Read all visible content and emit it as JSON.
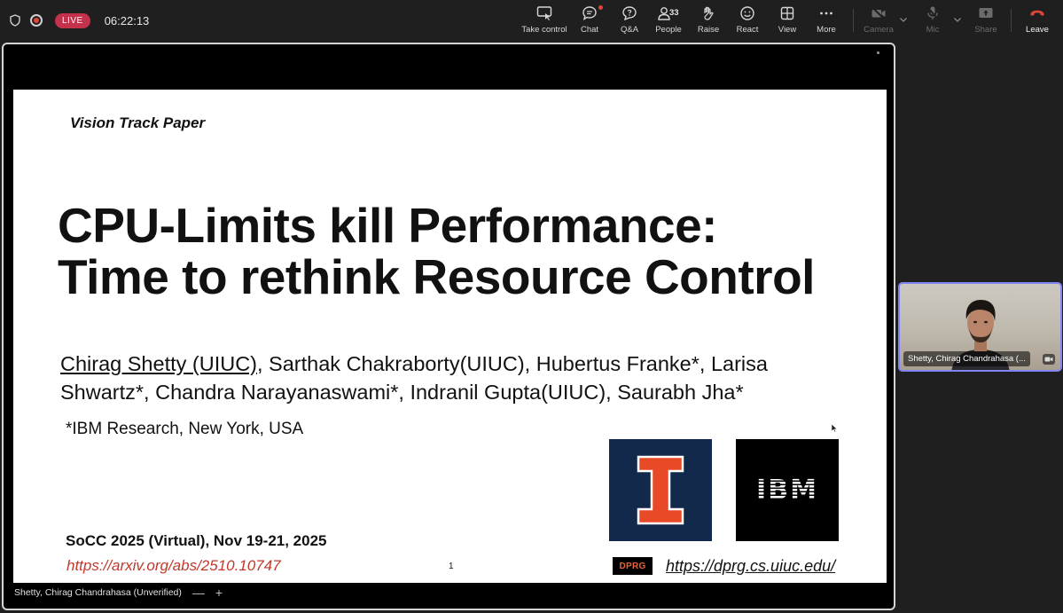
{
  "status": {
    "live_label": "LIVE",
    "timer": "06:22:13"
  },
  "toolbar": {
    "take_control": "Take control",
    "chat": "Chat",
    "qa": "Q&A",
    "people": "People",
    "people_count": "33",
    "raise": "Raise",
    "react": "React",
    "view": "View",
    "more": "More",
    "camera": "Camera",
    "mic": "Mic",
    "share": "Share",
    "leave": "Leave",
    "leave_color": "#e0453a"
  },
  "slide": {
    "track": "Vision Track Paper",
    "title_line1": "CPU-Limits kill Performance:",
    "title_line2": "Time to rethink Resource Control",
    "author_presenter": "Chirag Shetty (UIUC)",
    "authors_rest_line1": ", Sarthak Chakraborty(UIUC), Hubertus Franke*, Larisa",
    "authors_line2": "Shwartz*, Chandra Narayanaswami*, Indranil Gupta(UIUC), Saurabh Jha*",
    "affiliation": "*IBM Research, New York, USA",
    "conference": "SoCC 2025 (Virtual), Nov 19-21, 2025",
    "arxiv_link": "https://arxiv.org/abs/2510.10747",
    "page_number": "1",
    "ibm_logo": "IBM",
    "dprg_logo": "DPRG",
    "dprg_link": "https://dprg.cs.uiuc.edu/",
    "illinois_orange": "#e84a27",
    "illinois_blue": "#13294b"
  },
  "presenter_bar": {
    "name": "Shetty, Chirag Chandrahasa (Unverified)",
    "minus": "—",
    "plus": "+"
  },
  "participant_tile": {
    "name": "Shetty, Chirag Chandrahasa (..."
  }
}
